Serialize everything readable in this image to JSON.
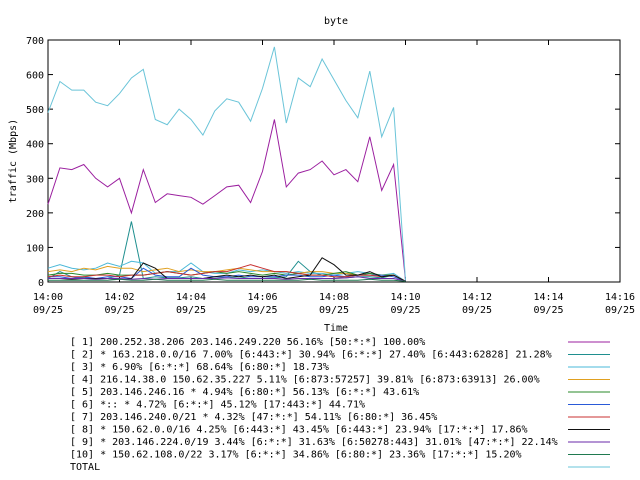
{
  "chart_data": {
    "type": "line",
    "title": "byte",
    "xlabel": "Time",
    "ylabel": "traffic (Mbps)",
    "ylim": [
      0,
      700
    ],
    "yticks": [
      0,
      100,
      200,
      300,
      400,
      500,
      600,
      700
    ],
    "xlim": [
      "14:00",
      "14:16"
    ],
    "xticks": [
      {
        "time": "14:00",
        "date": "09/25"
      },
      {
        "time": "14:02",
        "date": "09/25"
      },
      {
        "time": "14:04",
        "date": "09/25"
      },
      {
        "time": "14:06",
        "date": "09/25"
      },
      {
        "time": "14:08",
        "date": "09/25"
      },
      {
        "time": "14:10",
        "date": "09/25"
      },
      {
        "time": "14:12",
        "date": "09/25"
      },
      {
        "time": "14:14",
        "date": "09/25"
      },
      {
        "time": "14:16",
        "date": "09/25"
      }
    ],
    "grid": false,
    "legend_position": "bottom",
    "x": [
      "14:00:00",
      "14:00:20",
      "14:00:40",
      "14:01:00",
      "14:01:20",
      "14:01:40",
      "14:02:00",
      "14:02:20",
      "14:02:40",
      "14:03:00",
      "14:03:20",
      "14:03:40",
      "14:04:00",
      "14:04:20",
      "14:04:40",
      "14:05:00",
      "14:05:20",
      "14:05:40",
      "14:06:00",
      "14:06:20",
      "14:06:40",
      "14:07:00",
      "14:07:20",
      "14:07:40",
      "14:08:00",
      "14:08:20",
      "14:08:40",
      "14:09:00",
      "14:09:20",
      "14:09:40",
      "14:10:00",
      "14:10:20",
      "14:10:40",
      "14:11:00",
      "14:11:20",
      "14:11:40",
      "14:12:00",
      "14:12:20",
      "14:12:40",
      "14:13:00",
      "14:13:20",
      "14:13:40",
      "14:14:00",
      "14:14:20",
      "14:14:40",
      "14:15:00"
    ],
    "series": [
      {
        "name": "[ 1] 200.252.38.206 203.146.249.220 56.16% [50:*:*] 100.00%",
        "color": "#9b1f9f",
        "values": [
          225,
          330,
          325,
          340,
          300,
          275,
          300,
          200,
          325,
          230,
          255,
          250,
          245,
          225,
          250,
          275,
          280,
          230,
          320,
          470,
          275,
          315,
          325,
          350,
          310,
          325,
          290,
          420,
          265,
          340,
          5
        ]
      },
      {
        "name": "[ 2] * 163.218.0.0/16 7.00% [6:443:*] 30.94% [6:*:*] 27.40% [6:443:62828] 21.28%",
        "color": "#1f8f8f",
        "values": [
          10,
          30,
          15,
          12,
          10,
          10,
          20,
          175,
          10,
          15,
          12,
          12,
          15,
          10,
          15,
          12,
          15,
          10,
          10,
          12,
          15,
          60,
          30,
          20,
          15,
          12,
          15,
          15,
          12,
          20,
          2
        ]
      },
      {
        "name": "[ 3] * 6.90% [6:*:*] 68.64% [6:80:*] 18.73%",
        "color": "#4ab8d8",
        "values": [
          40,
          50,
          40,
          35,
          40,
          55,
          45,
          60,
          55,
          25,
          30,
          30,
          55,
          30,
          25,
          25,
          35,
          30,
          35,
          30,
          25,
          30,
          25,
          25,
          20,
          25,
          30,
          25,
          20,
          25,
          2
        ]
      },
      {
        "name": "[ 4] 216.14.38.0 150.62.35.227 5.11% [6:873:57257] 39.81% [6:873:63913] 26.00%",
        "color": "#e0a020",
        "values": [
          30,
          35,
          30,
          40,
          35,
          45,
          40,
          40,
          30,
          35,
          40,
          30,
          35,
          30,
          30,
          35,
          40,
          35,
          30,
          30,
          30,
          25,
          30,
          30,
          25,
          25,
          20,
          20,
          20,
          20,
          2
        ]
      },
      {
        "name": "[ 5] 203.146.246.16 * 4.94% [6:80:*] 56.13% [6:*:*] 43.61%",
        "color": "#2a8a2a",
        "values": [
          20,
          25,
          25,
          20,
          20,
          25,
          20,
          20,
          20,
          25,
          30,
          25,
          20,
          25,
          30,
          25,
          30,
          25,
          20,
          25,
          20,
          25,
          20,
          20,
          25,
          30,
          20,
          25,
          20,
          20,
          2
        ]
      },
      {
        "name": "[ 6] *:: * 4.72% [6:*:*] 45.12% [17:443:*] 44.71%",
        "color": "#2a5ad8",
        "values": [
          15,
          15,
          10,
          15,
          10,
          15,
          15,
          10,
          40,
          20,
          15,
          15,
          40,
          20,
          15,
          15,
          20,
          15,
          15,
          15,
          20,
          20,
          15,
          15,
          20,
          15,
          20,
          20,
          20,
          15,
          2
        ]
      },
      {
        "name": "[ 7] 203.146.240.0/21 * 4.32% [47:*:*] 54.11% [6:80:*] 36.45%",
        "color": "#c83030",
        "values": [
          15,
          20,
          15,
          15,
          20,
          20,
          15,
          20,
          20,
          25,
          30,
          25,
          20,
          25,
          30,
          30,
          40,
          50,
          40,
          30,
          30,
          25,
          20,
          20,
          15,
          15,
          20,
          20,
          15,
          20,
          2
        ]
      },
      {
        "name": "[ 8] * 150.62.0.0/16 4.25% [6:443:*] 43.45% [6:443:*] 23.94% [17:*:*] 17.86%",
        "color": "#111111",
        "values": [
          10,
          10,
          8,
          10,
          10,
          10,
          8,
          10,
          55,
          40,
          10,
          10,
          10,
          10,
          15,
          20,
          15,
          20,
          15,
          20,
          10,
          15,
          20,
          70,
          50,
          20,
          20,
          30,
          15,
          20,
          2
        ]
      },
      {
        "name": "[ 9] * 203.146.224.0/19 3.44% [6:*:*] 31.63% [6:50278:443] 31.01% [47:*:*] 22.14%",
        "color": "#6a2aa8",
        "values": [
          10,
          10,
          10,
          10,
          8,
          10,
          10,
          8,
          10,
          8,
          10,
          10,
          10,
          10,
          10,
          12,
          10,
          10,
          10,
          10,
          8,
          10,
          10,
          10,
          10,
          12,
          15,
          10,
          10,
          10,
          2
        ]
      },
      {
        "name": "[10] * 150.62.108.0/22 3.17% [6:*:*] 34.86% [6:80:*] 23.36% [17:*:*] 15.20%",
        "color": "#207a50",
        "values": [
          5,
          5,
          5,
          5,
          5,
          5,
          8,
          5,
          5,
          8,
          5,
          5,
          5,
          5,
          8,
          5,
          5,
          5,
          5,
          5,
          5,
          5,
          8,
          5,
          5,
          5,
          5,
          8,
          5,
          5,
          2
        ]
      },
      {
        "name": "TOTAL",
        "color": "#6ac4d8",
        "values": [
          490,
          580,
          555,
          555,
          520,
          510,
          545,
          590,
          615,
          470,
          455,
          500,
          470,
          425,
          495,
          530,
          520,
          465,
          560,
          680,
          460,
          590,
          565,
          645,
          585,
          525,
          475,
          610,
          420,
          505,
          5
        ]
      }
    ]
  }
}
